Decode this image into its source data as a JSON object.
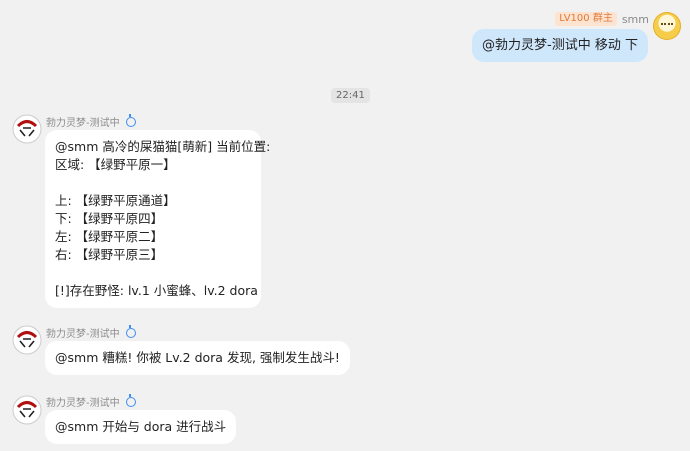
{
  "outgoing": {
    "badge": "LV100 群主",
    "user": "smm",
    "text": "@勃力灵梦-测试中 移动 下"
  },
  "divider_time": "22:41",
  "bot_name": "勃力灵梦-测试中",
  "messages": [
    {
      "lines": [
        "@smm 高冷的屎猫猫[萌新] 当前位置:",
        "区域: 【绿野平原一】",
        "",
        "上: 【绿野平原通道】",
        "下: 【绿野平原四】",
        "左: 【绿野平原二】",
        "右: 【绿野平原三】",
        "",
        "[!]存在野怪: lv.1 小蜜蜂、lv.2 dora"
      ]
    },
    {
      "lines": [
        "@smm 糟糕! 你被 Lv.2 dora 发现, 强制发生战斗!"
      ]
    },
    {
      "lines": [
        "@smm 开始与 dora 进行战斗"
      ]
    }
  ]
}
